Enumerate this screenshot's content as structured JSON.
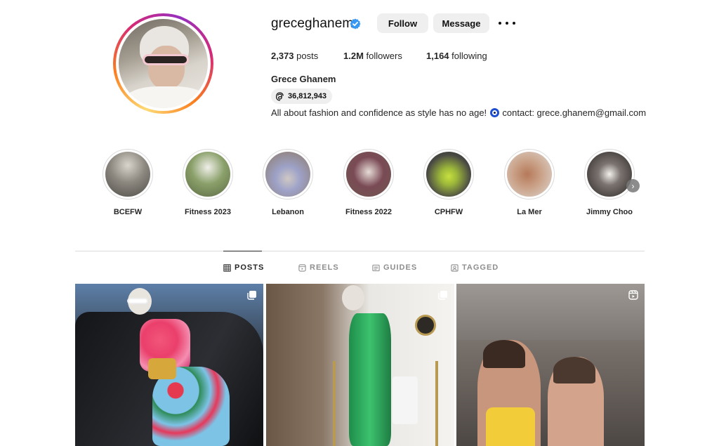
{
  "profile": {
    "username": "greceghanem",
    "verified": true,
    "follow_label": "Follow",
    "message_label": "Message",
    "stats": {
      "posts_value": "2,373",
      "posts_label": "posts",
      "followers_value": "1.2M",
      "followers_label": "followers",
      "following_value": "1,164",
      "following_label": "following"
    },
    "full_name": "Grece Ghanem",
    "threads_count": "36,812,943",
    "bio_before": "All about fashion and confidence as style has no age!",
    "bio_after": "contact: grece.ghanem@gmail.com"
  },
  "highlights": [
    {
      "label": "BCEFW",
      "color": "#7d7a74"
    },
    {
      "label": "Fitness 2023",
      "color": "#8c8b7a"
    },
    {
      "label": "Lebanon",
      "color": "#a89a8c"
    },
    {
      "label": "Fitness 2022",
      "color": "#8f7b78"
    },
    {
      "label": "CPHFW",
      "color": "#6e7a6c"
    },
    {
      "label": "La Mer",
      "color": "#a58a72"
    },
    {
      "label": "Jimmy Choo",
      "color": "#5b5350"
    }
  ],
  "tabs": {
    "posts": "POSTS",
    "reels": "REELS",
    "guides": "GUIDES",
    "tagged": "TAGGED"
  },
  "posts": [
    {
      "type": "carousel"
    },
    {
      "type": "carousel"
    },
    {
      "type": "reel"
    }
  ],
  "colors": {
    "verified_blue": "#3897f0",
    "button_bg": "#efefef",
    "text_primary": "#262626",
    "text_secondary": "#8e8e8e"
  }
}
